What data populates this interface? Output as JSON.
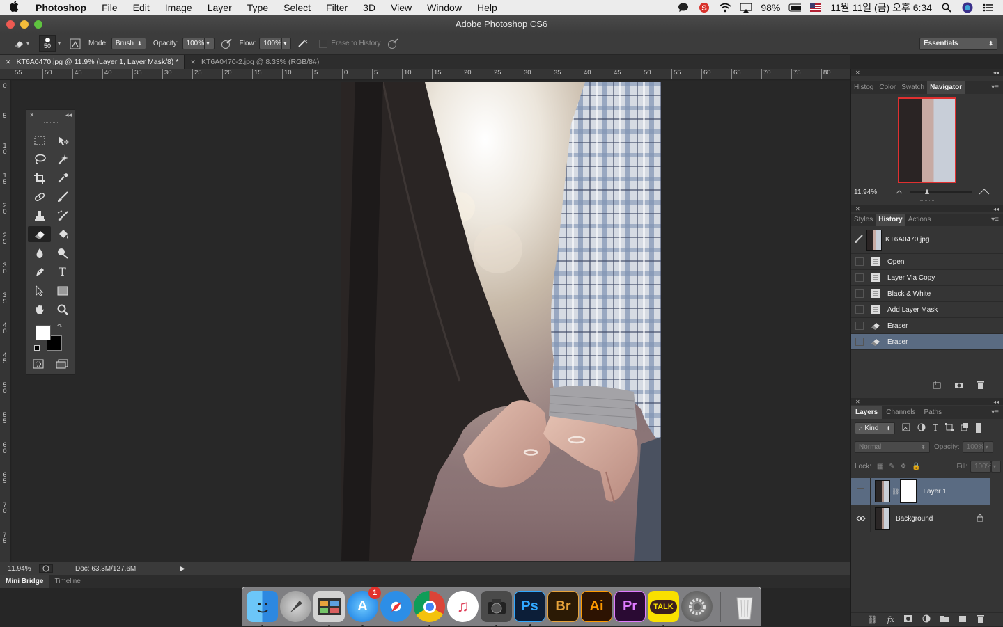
{
  "menubar": {
    "app_name": "Photoshop",
    "items": [
      "File",
      "Edit",
      "Image",
      "Layer",
      "Type",
      "Select",
      "Filter",
      "3D",
      "View",
      "Window",
      "Help"
    ],
    "battery": "98%",
    "datetime": "11월 11일 (금) 오후 6:34"
  },
  "window": {
    "title": "Adobe Photoshop CS6"
  },
  "options": {
    "brush_size": "50",
    "mode_label": "Mode:",
    "mode_value": "Brush",
    "opacity_label": "Opacity:",
    "opacity_value": "100%",
    "flow_label": "Flow:",
    "flow_value": "100%",
    "erase_history": "Erase to History",
    "workspace": "Essentials"
  },
  "tabs": [
    {
      "label": "KT6A0470.jpg @ 11.9% (Layer 1, Layer Mask/8) *",
      "active": true
    },
    {
      "label": "KT6A0470-2.jpg @ 8.33% (RGB/8#)",
      "active": false
    }
  ],
  "ruler": {
    "h_labels": [
      "55",
      "50",
      "45",
      "40",
      "35",
      "30",
      "25",
      "20",
      "15",
      "10",
      "5",
      "0",
      "5",
      "10",
      "15",
      "20",
      "25",
      "30",
      "35",
      "40",
      "45",
      "50",
      "55",
      "60",
      "65",
      "70",
      "75",
      "80"
    ],
    "v_labels": [
      "0",
      "5",
      "1 0",
      "1 5",
      "2 0",
      "2 5",
      "3 0",
      "3 5",
      "4 0",
      "4 5",
      "5 0",
      "5 5",
      "6 0",
      "6 5",
      "7 0",
      "7 5"
    ]
  },
  "status": {
    "zoom": "11.94%",
    "doc": "Doc: 63.3M/127.6M"
  },
  "bottom_tabs": [
    "Mini Bridge",
    "Timeline"
  ],
  "navigator": {
    "tabs": [
      "Histog",
      "Color",
      "Swatch",
      "Navigator"
    ],
    "zoom": "11.94%"
  },
  "history": {
    "tabs": [
      "Styles",
      "History",
      "Actions"
    ],
    "snapshot": "KT6A0470.jpg",
    "items": [
      "Open",
      "Layer Via Copy",
      "Black & White",
      "Add Layer Mask",
      "Eraser",
      "Eraser"
    ]
  },
  "layers": {
    "tabs": [
      "Layers",
      "Channels",
      "Paths"
    ],
    "kind": "Kind",
    "blend": "Normal",
    "opacity_label": "Opacity:",
    "opacity_value": "100%",
    "lock_label": "Lock:",
    "fill_label": "Fill:",
    "fill_value": "100%",
    "items": [
      {
        "name": "Layer 1",
        "selected": true,
        "visible": false
      },
      {
        "name": "Background",
        "selected": false,
        "visible": true
      }
    ]
  },
  "dock": {
    "badge": "1",
    "apps": [
      "Finder",
      "Launchpad",
      "Photo Booth",
      "App Store",
      "Safari",
      "Chrome",
      "iTunes",
      "Image Capture",
      "Ps",
      "Br",
      "Ai",
      "Pr",
      "TALK",
      "System Preferences",
      "Trash"
    ]
  },
  "colors": {
    "accent": "#5a6b82",
    "panel": "#353535"
  }
}
